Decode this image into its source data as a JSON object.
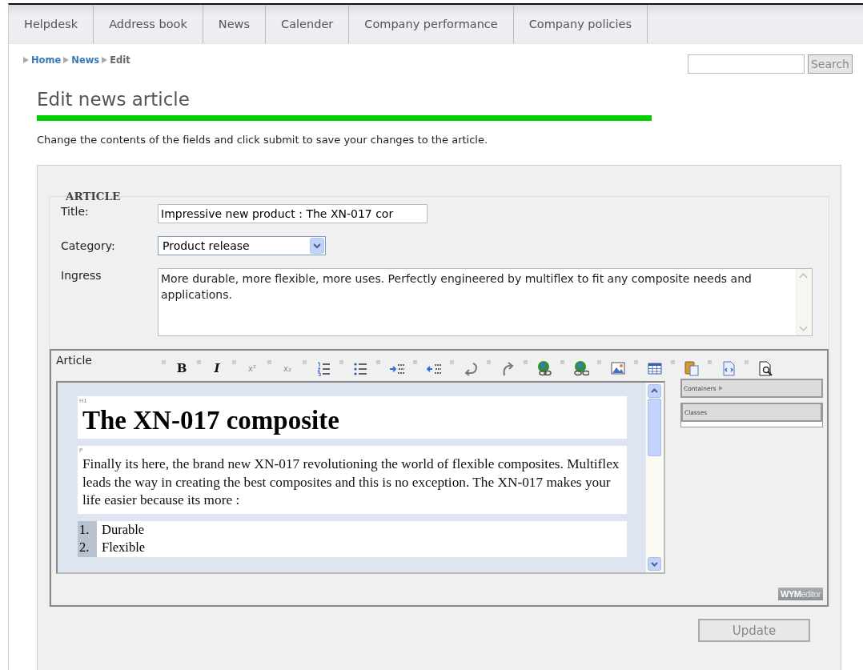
{
  "nav": {
    "tabs": [
      {
        "label": "Helpdesk",
        "selected": false
      },
      {
        "label": "Address book",
        "selected": false
      },
      {
        "label": "News",
        "selected": false
      },
      {
        "label": "Calender",
        "selected": false
      },
      {
        "label": "Company performance",
        "selected": false
      },
      {
        "label": "Company policies",
        "selected": false
      }
    ]
  },
  "breadcrumb": [
    {
      "label": "Home",
      "link": true
    },
    {
      "label": "News",
      "link": true
    },
    {
      "label": "Edit",
      "link": false
    }
  ],
  "search": {
    "button": "Search"
  },
  "heading": "Edit news article",
  "intro": "Change the contents of the fields and click submit to save your changes to the article.",
  "form": {
    "legend": "ARTICLE",
    "title": {
      "label": "Title:",
      "value": "Impressive new product : The XN-017 cor"
    },
    "category": {
      "label": "Category:",
      "value": "Product release"
    },
    "ingress": {
      "label": "Ingress",
      "value": "More durable, more flexible, more uses. Perfectly engineered by multiflex to fit any composite needs and applications."
    },
    "article": {
      "label": "Article",
      "toolbar": [
        {
          "kind": "bold",
          "label": "B"
        },
        {
          "kind": "italic",
          "label": "I"
        },
        {
          "kind": "sup",
          "label": "x²"
        },
        {
          "kind": "sub",
          "label": "x₂"
        },
        {
          "kind": "ordered-list"
        },
        {
          "kind": "unordered-list"
        },
        {
          "kind": "indent"
        },
        {
          "kind": "outdent"
        },
        {
          "kind": "undo"
        },
        {
          "kind": "redo"
        },
        {
          "kind": "link"
        },
        {
          "kind": "unlink"
        },
        {
          "kind": "image"
        },
        {
          "kind": "table"
        },
        {
          "kind": "paste"
        },
        {
          "kind": "html"
        },
        {
          "kind": "preview"
        }
      ],
      "content": [
        {
          "kind": "h1",
          "tag": "H1",
          "text": "The XN-017 composite"
        },
        {
          "kind": "p",
          "tag": "P",
          "text": "Finally its here, the brand new XN-017 revolutioning the world of flexible composites. Multiflex leads the way in creating the best composites and this is no exception. The XN-017 makes your life easier because its more :"
        },
        {
          "kind": "ol",
          "items": [
            {
              "number": "1.",
              "text": "Durable"
            },
            {
              "number": "2.",
              "text": "Flexible"
            }
          ]
        }
      ],
      "panels": [
        {
          "label": "Containers",
          "arrow": true
        },
        {
          "label": "Classes",
          "arrow": false
        }
      ],
      "logo": {
        "strong": "WYM",
        "rest": "editor"
      }
    },
    "submit": {
      "label": "Update",
      "disabled": true
    }
  }
}
